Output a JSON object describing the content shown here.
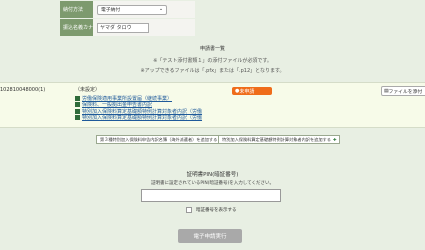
{
  "form": {
    "payment_label": "納付方法",
    "payment_value": "電子納付",
    "payer_kana_label": "振込名義カナ",
    "payer_kana_value": "ヤマダ タロウ"
  },
  "list": {
    "title": "申請書一覧",
    "note1": "※「テスト添付書類１」の添付ファイルが必須です。",
    "note2": "※アップできるファイルは「.pfx」または「.p12」となります。"
  },
  "procedure": {
    "id": "102810048000(1)",
    "header": "（未設定）",
    "items": [
      "労働保険適用事業所設置届（継続事業）",
      "保険料、一般拠出金申告書内訳",
      "特別加入保険料算定基礎額特例計算対象者内訳（労働",
      "特別加入保険料算定基礎額特例計算対象者内訳（労働"
    ],
    "status": "未申請",
    "attach_label": "ファイルを添付"
  },
  "sub_buttons": {
    "left": "第３種特別加入保険料申告内訳名簿（海外派遣者）を追加する",
    "right": "特別加入保険料算定基礎額特例計算対象者内訳を追加する"
  },
  "pin": {
    "title": "証明書PIN(暗証番号)",
    "description": "証明書に設定されているPIN(暗証番号)を入力してください。",
    "show_label": "暗証番号を表示する"
  },
  "submit_label": "電子申請実行",
  "colors": {
    "label_bg": "#7d9a6e",
    "status_badge": "#ef6c1a",
    "submit_disabled": "#a9a9a9"
  }
}
